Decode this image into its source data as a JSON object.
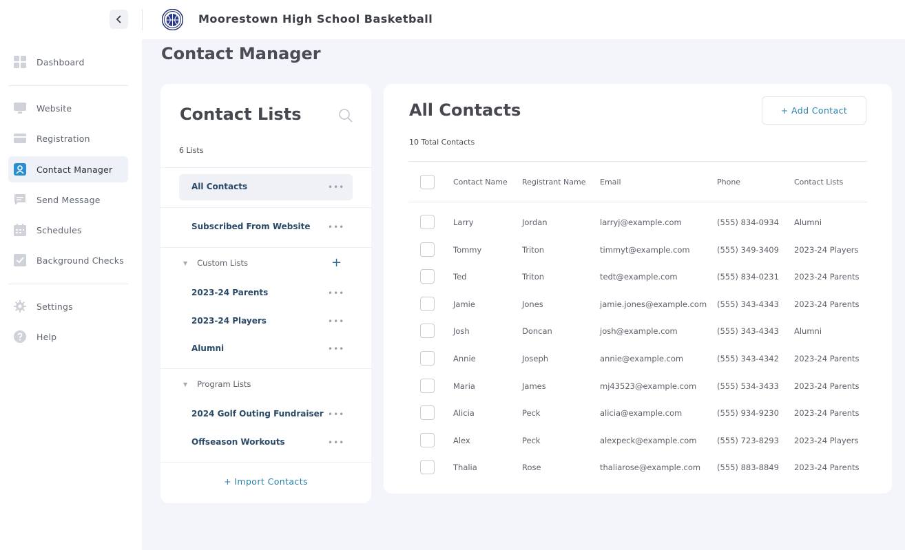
{
  "app": {
    "title": "Moorestown High School Basketball"
  },
  "sidebar": {
    "items": [
      {
        "label": "Dashboard",
        "icon": "dashboard-icon"
      },
      {
        "label": "Website",
        "icon": "monitor-icon"
      },
      {
        "label": "Registration",
        "icon": "card-icon"
      },
      {
        "label": "Contact Manager",
        "icon": "contact-icon"
      },
      {
        "label": "Send Message",
        "icon": "message-icon"
      },
      {
        "label": "Schedules",
        "icon": "calendar-icon"
      },
      {
        "label": "Background Checks",
        "icon": "check-icon"
      },
      {
        "label": "Settings",
        "icon": "gear-icon"
      },
      {
        "label": "Help",
        "icon": "help-icon"
      }
    ]
  },
  "page": {
    "title": "Contact Manager"
  },
  "contact_lists": {
    "title": "Contact Lists",
    "count_label": "6 Lists",
    "all_contacts": "All Contacts",
    "subscribed": "Subscribed From Website",
    "custom_header": "Custom Lists",
    "custom": [
      "2023-24 Parents",
      "2023-24 Players",
      "Alumni"
    ],
    "program_header": "Program Lists",
    "program": [
      "2024 Golf Outing Fundraiser",
      "Offseason Workouts"
    ],
    "more_glyph": "•••",
    "add_glyph": "+",
    "import_label": "+ Import Contacts"
  },
  "contacts": {
    "title": "All Contacts",
    "add_label": "+ Add Contact",
    "total_label": "10 Total Contacts",
    "columns": [
      "Contact Name",
      "Registrant Name",
      "Email",
      "Phone",
      "Contact Lists"
    ],
    "rows": [
      [
        "Larry",
        "Jordan",
        "larryj@example.com",
        "(555) 834-0934",
        "Alumni"
      ],
      [
        "Tommy",
        "Triton",
        "timmyt@example.com",
        "(555) 349-3409",
        "2023-24 Players"
      ],
      [
        "Ted",
        "Triton",
        "tedt@example.com",
        "(555) 834-0231",
        "2023-24 Parents"
      ],
      [
        "Jamie",
        "Jones",
        "jamie.jones@example.com",
        "(555) 343-4343",
        "2023-24 Parents"
      ],
      [
        "Josh",
        "Doncan",
        "josh@example.com",
        "(555) 343-4343",
        "Alumni"
      ],
      [
        "Annie",
        "Joseph",
        "annie@example.com",
        "(555) 343-4342",
        "2023-24 Parents"
      ],
      [
        "Maria",
        "James",
        "mj43523@example.com",
        "(555) 534-3433",
        "2023-24 Parents"
      ],
      [
        "Alicia",
        "Peck",
        "alicia@example.com",
        "(555) 934-9230",
        "2023-24 Parents"
      ],
      [
        "Alex",
        "Peck",
        "alexpeck@example.com",
        "(555) 723-8293",
        "2023-24 Players"
      ],
      [
        "Thalia",
        "Rose",
        "thaliarose@example.com",
        "(555) 883-8849",
        "2023-24 Parents"
      ]
    ]
  },
  "colors": {
    "accent": "#2a7fab",
    "active_icon": "#2a8fd0",
    "list_name": "#2b4a68"
  }
}
